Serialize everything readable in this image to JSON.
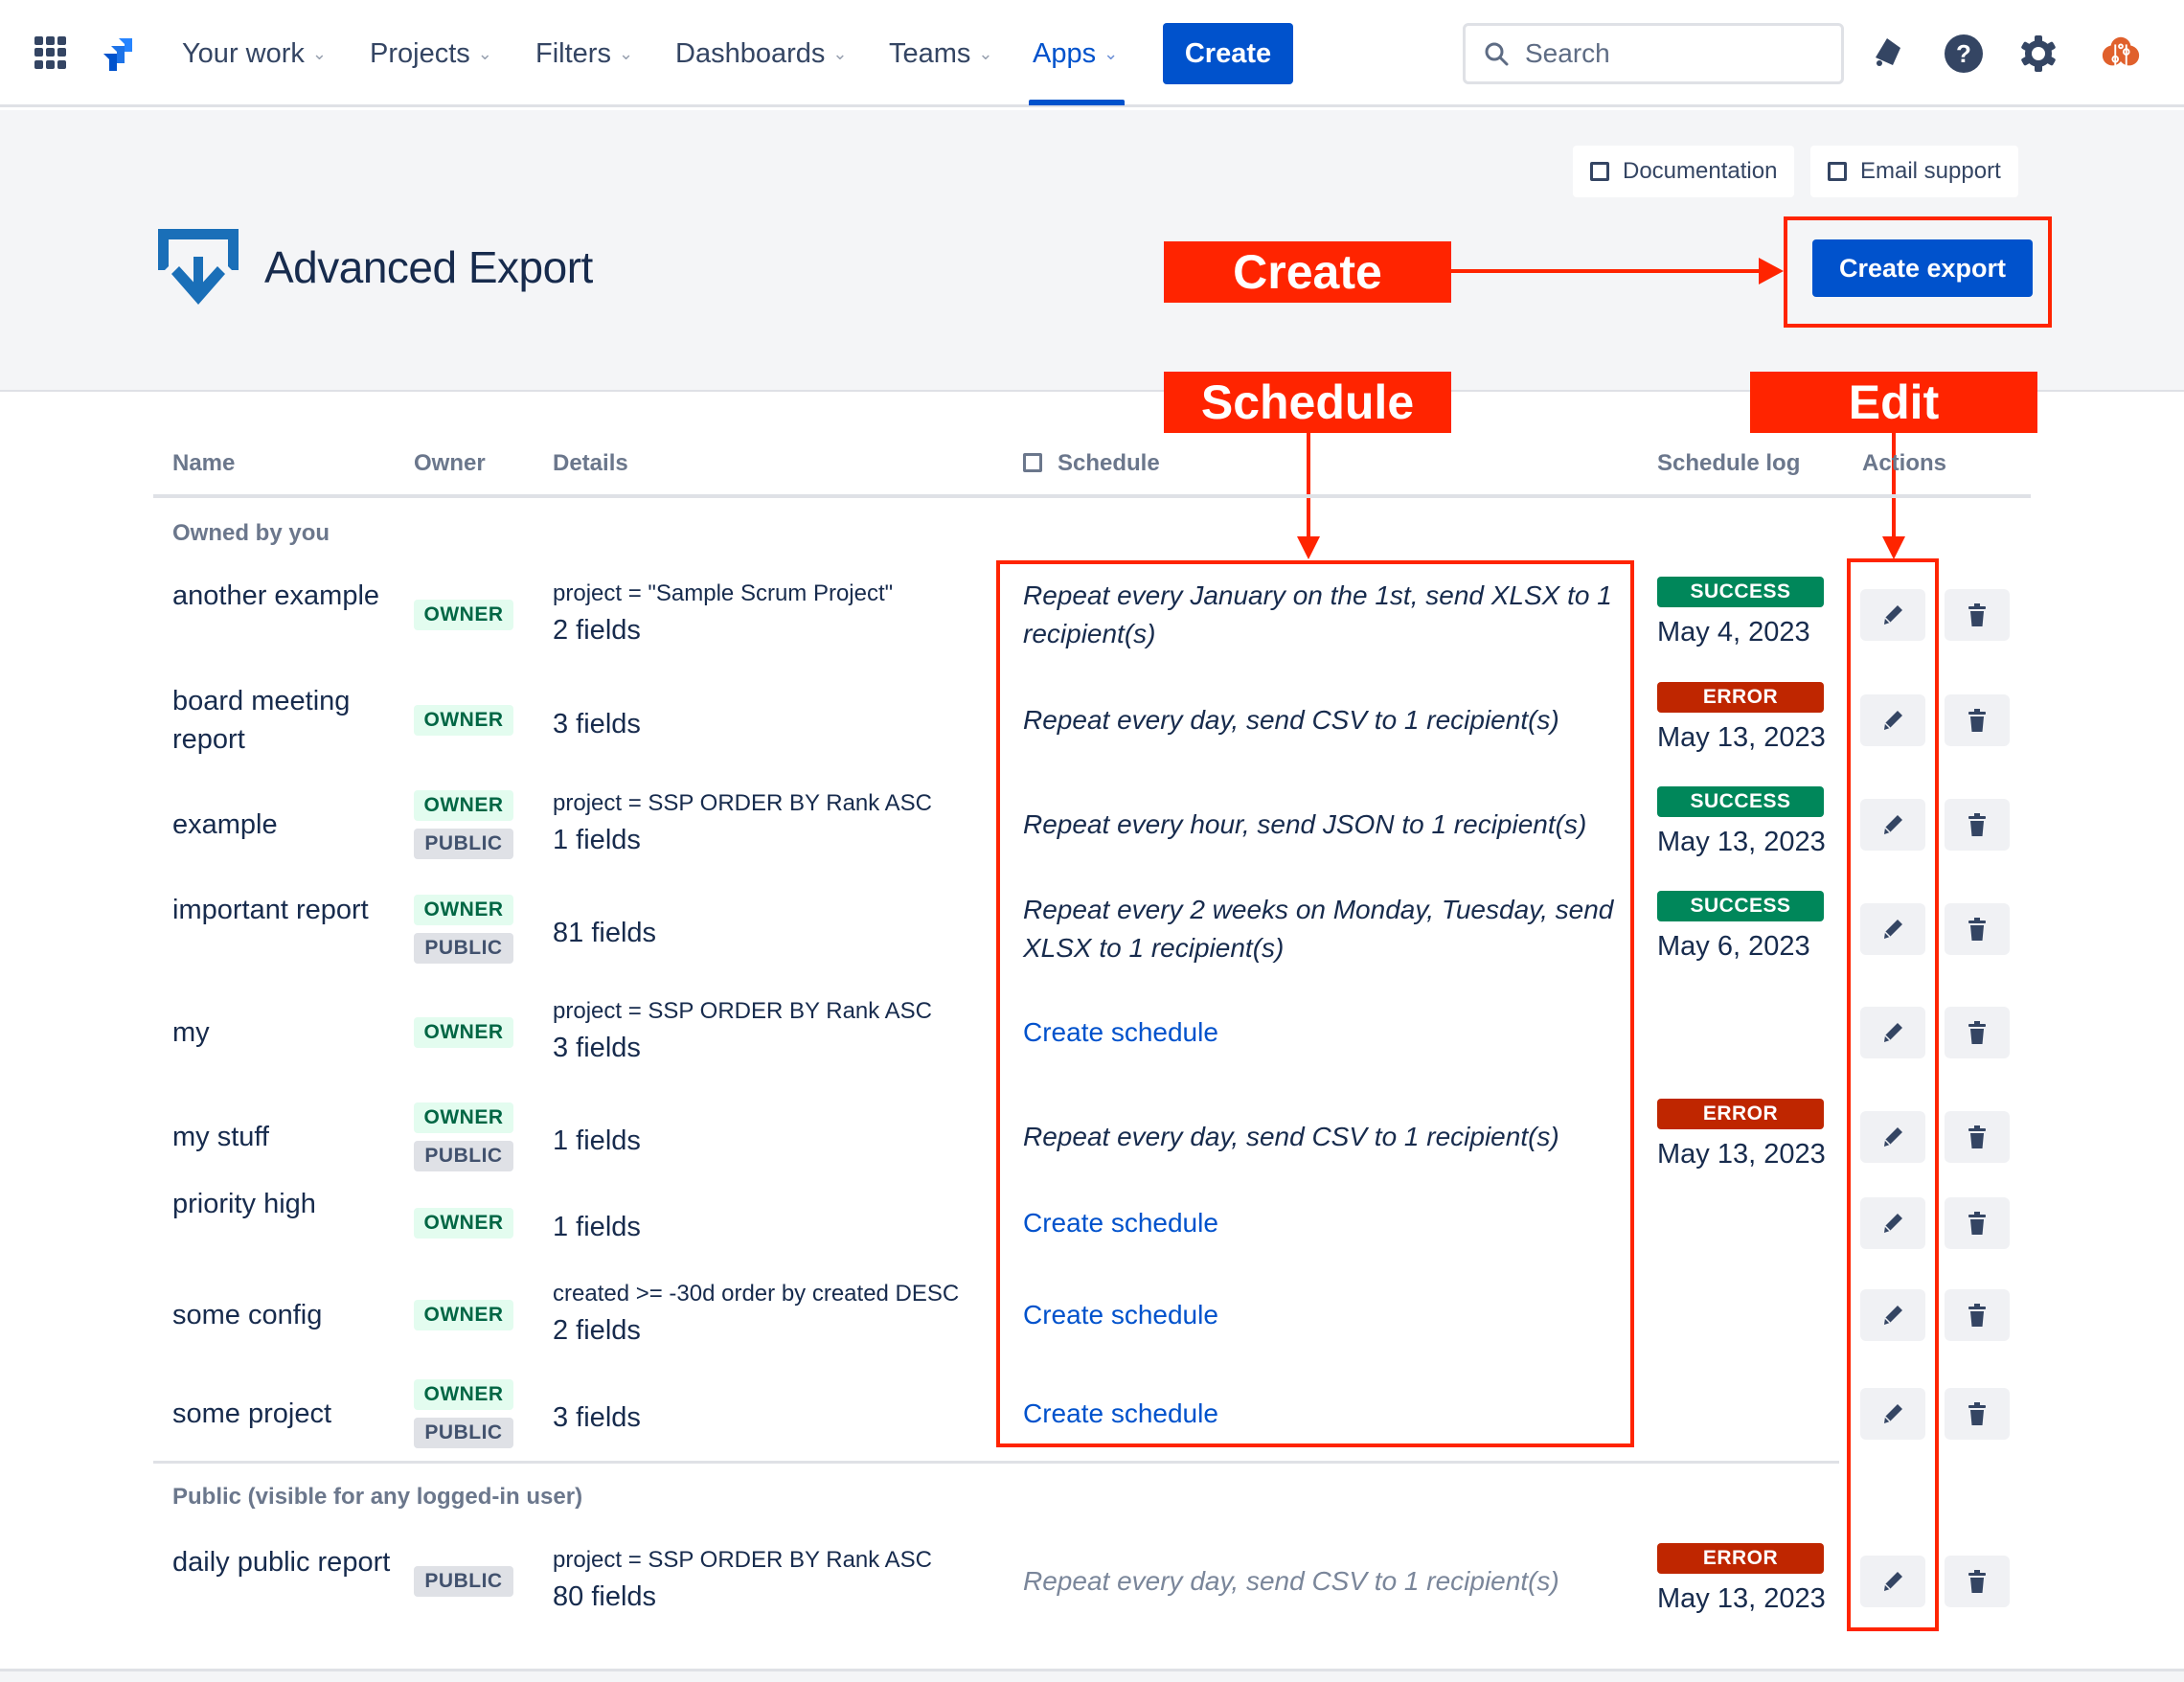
{
  "topnav": {
    "items": [
      {
        "label": "Your work",
        "active": false
      },
      {
        "label": "Projects",
        "active": false
      },
      {
        "label": "Filters",
        "active": false
      },
      {
        "label": "Dashboards",
        "active": false
      },
      {
        "label": "Teams",
        "active": false
      },
      {
        "label": "Apps",
        "active": true
      }
    ],
    "create_label": "Create",
    "search_placeholder": "Search",
    "icons": [
      "app-switcher-icon",
      "jira-logo-icon",
      "notifications-icon",
      "help-icon",
      "settings-icon",
      "profile-avatar-icon"
    ]
  },
  "header": {
    "help_links": [
      {
        "label": "Documentation"
      },
      {
        "label": "Email support"
      }
    ],
    "app_title": "Advanced Export",
    "create_export_label": "Create export"
  },
  "annotations": {
    "create": "Create",
    "schedule": "Schedule",
    "edit": "Edit",
    "color": "#ff2400"
  },
  "table": {
    "columns": [
      "Name",
      "Owner",
      "Details",
      "Schedule",
      "Schedule log",
      "Actions"
    ],
    "groups": [
      {
        "label": "Owned by you",
        "rows": [
          {
            "name": "another example",
            "badges": [
              "OWNER"
            ],
            "jql": "project = \"Sample Scrum Project\"",
            "fields": "2 fields",
            "schedule": "Repeat every January on the 1st, send XLSX to 1 recipient(s)",
            "schedule_type": "text",
            "log_status": "SUCCESS",
            "log_date": "May 4, 2023"
          },
          {
            "name": "board meeting report",
            "badges": [
              "OWNER"
            ],
            "jql": "",
            "fields": "3 fields",
            "schedule": "Repeat every day, send CSV to 1 recipient(s)",
            "schedule_type": "text",
            "log_status": "ERROR",
            "log_date": "May 13, 2023"
          },
          {
            "name": "example",
            "badges": [
              "OWNER",
              "PUBLIC"
            ],
            "jql": "project = SSP ORDER BY Rank ASC",
            "fields": "1 fields",
            "schedule": "Repeat every hour, send JSON to 1 recipient(s)",
            "schedule_type": "text",
            "log_status": "SUCCESS",
            "log_date": "May 13, 2023"
          },
          {
            "name": "important report",
            "badges": [
              "OWNER",
              "PUBLIC"
            ],
            "jql": "",
            "fields": "81 fields",
            "schedule": "Repeat every 2 weeks on Monday, Tuesday, send XLSX to 1 recipient(s)",
            "schedule_type": "text",
            "log_status": "SUCCESS",
            "log_date": "May 6, 2023"
          },
          {
            "name": "my",
            "badges": [
              "OWNER"
            ],
            "jql": "project = SSP ORDER BY Rank ASC",
            "fields": "3 fields",
            "schedule": "Create schedule",
            "schedule_type": "link",
            "log_status": "",
            "log_date": ""
          },
          {
            "name": "my stuff",
            "badges": [
              "OWNER",
              "PUBLIC"
            ],
            "jql": "",
            "fields": "1 fields",
            "schedule": "Repeat every day, send CSV to 1 recipient(s)",
            "schedule_type": "text",
            "log_status": "ERROR",
            "log_date": "May 13, 2023"
          },
          {
            "name": "priority high",
            "badges": [
              "OWNER"
            ],
            "jql": "",
            "fields": "1 fields",
            "schedule": "Create schedule",
            "schedule_type": "link",
            "log_status": "",
            "log_date": ""
          },
          {
            "name": "some config",
            "badges": [
              "OWNER"
            ],
            "jql": "created >= -30d order by created DESC",
            "fields": "2 fields",
            "schedule": "Create schedule",
            "schedule_type": "link",
            "log_status": "",
            "log_date": ""
          },
          {
            "name": "some project",
            "badges": [
              "OWNER",
              "PUBLIC"
            ],
            "jql": "",
            "fields": "3 fields",
            "schedule": "Create schedule",
            "schedule_type": "link",
            "log_status": "",
            "log_date": ""
          }
        ]
      },
      {
        "label": "Public (visible for any logged-in user)",
        "rows": [
          {
            "name": "daily public report",
            "badges": [
              "PUBLIC"
            ],
            "jql": "project = SSP ORDER BY Rank ASC",
            "fields": "80 fields",
            "schedule": "Repeat every day, send CSV to 1 recipient(s)",
            "schedule_type": "muted",
            "log_status": "ERROR",
            "log_date": "May 13, 2023"
          }
        ]
      }
    ]
  },
  "colors": {
    "brand_blue": "#0052cc",
    "success": "#00875a",
    "error": "#bf2600",
    "owner_badge_bg": "#e3fcef",
    "owner_badge_text": "#006644",
    "public_badge_bg": "#dfe1e6"
  }
}
